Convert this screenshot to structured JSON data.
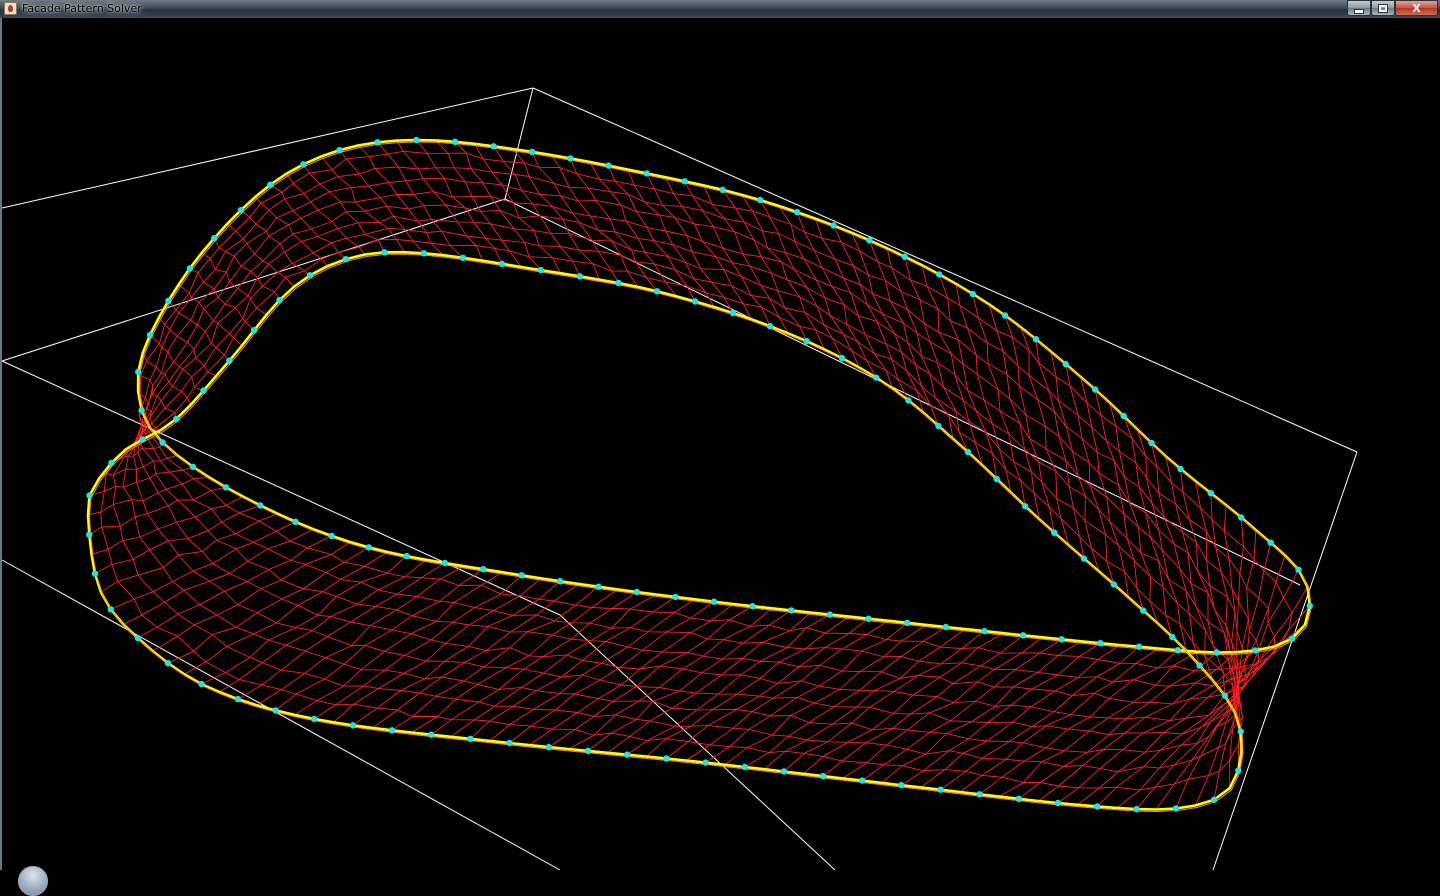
{
  "window": {
    "title": "Facade Pattern Solver",
    "icon": "java-cup-icon",
    "controls": {
      "minimize_icon": "minimize-icon",
      "maximize_icon": "restore-icon",
      "close_label": "X"
    }
  },
  "viewport": {
    "background": "#000000",
    "colors": {
      "bounding_box": "#ffffff",
      "mesh": "#ff2020",
      "boundary_curve": "#ffff00",
      "boundary_inner_curve": "#ff8c1a",
      "control_points": "#19e6e6"
    }
  }
}
